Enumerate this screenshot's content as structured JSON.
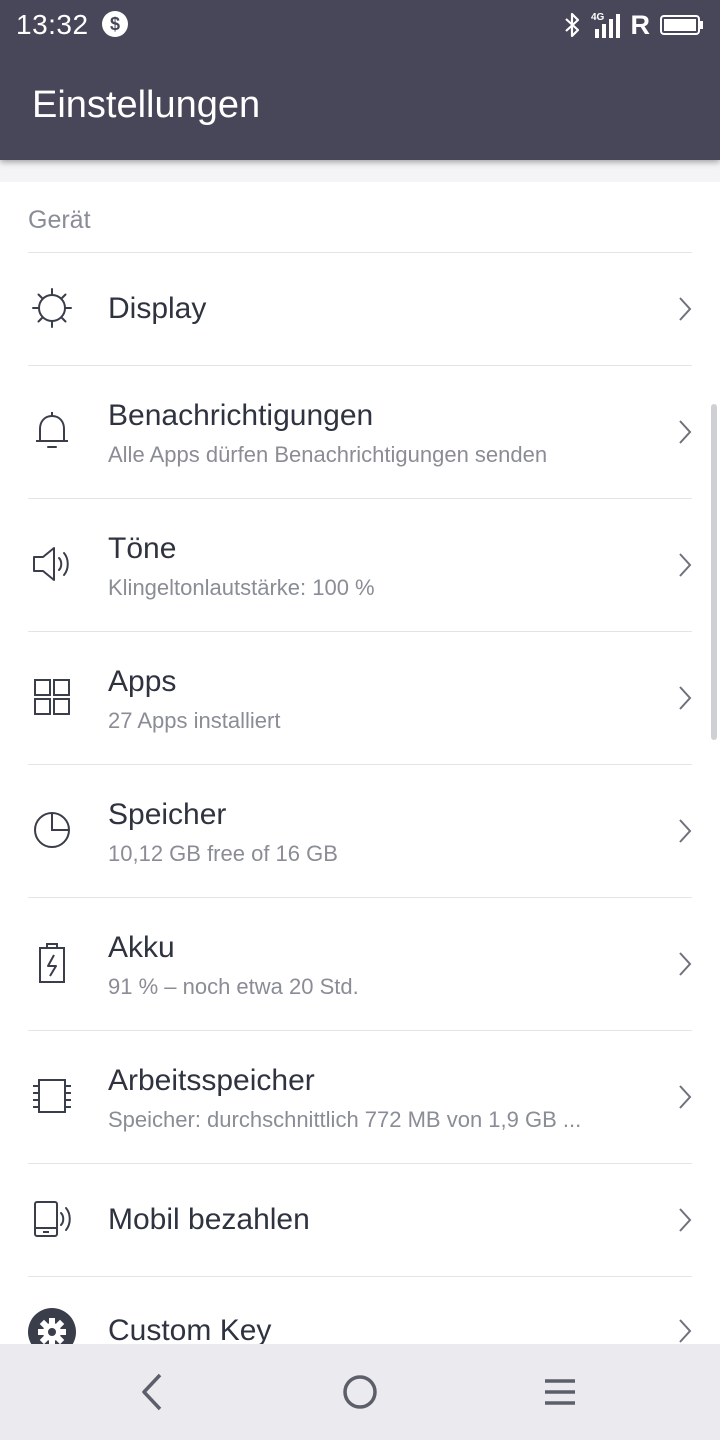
{
  "status_bar": {
    "time": "13:32",
    "notification_icon": "dollar-circle-icon",
    "network": "4G",
    "roaming": "R",
    "icons": [
      "bluetooth-icon",
      "signal-icon",
      "battery-icon"
    ]
  },
  "header": {
    "title": "Einstellungen"
  },
  "section": {
    "label": "Gerät"
  },
  "items": [
    {
      "icon": "brightness-icon",
      "title": "Display",
      "subtitle": ""
    },
    {
      "icon": "bell-icon",
      "title": "Benachrichtigungen",
      "subtitle": "Alle Apps dürfen Benachrichtigungen senden"
    },
    {
      "icon": "speaker-icon",
      "title": "Töne",
      "subtitle": "Klingeltonlautstärke: 100 %"
    },
    {
      "icon": "apps-grid-icon",
      "title": "Apps",
      "subtitle": "27 Apps installiert"
    },
    {
      "icon": "storage-pie-icon",
      "title": "Speicher",
      "subtitle": "10,12 GB free of 16 GB"
    },
    {
      "icon": "battery-charging-icon",
      "title": "Akku",
      "subtitle": "91 % – noch etwa 20 Std."
    },
    {
      "icon": "memory-chip-icon",
      "title": "Arbeitsspeicher",
      "subtitle": "Speicher: durchschnittlich 772 MB von 1,9 GB ..."
    },
    {
      "icon": "mobile-pay-icon",
      "title": "Mobil bezahlen",
      "subtitle": ""
    },
    {
      "icon": "gear-icon",
      "title": "Custom Key",
      "subtitle": ""
    }
  ],
  "nav": {
    "icons": [
      "back-icon",
      "home-icon",
      "menu-icon"
    ]
  },
  "colors": {
    "header": "#474759",
    "text": "#2f3340",
    "secondary_text": "#8a8d96",
    "divider": "#e3e4e7",
    "nav_bar": "#ebebef"
  }
}
